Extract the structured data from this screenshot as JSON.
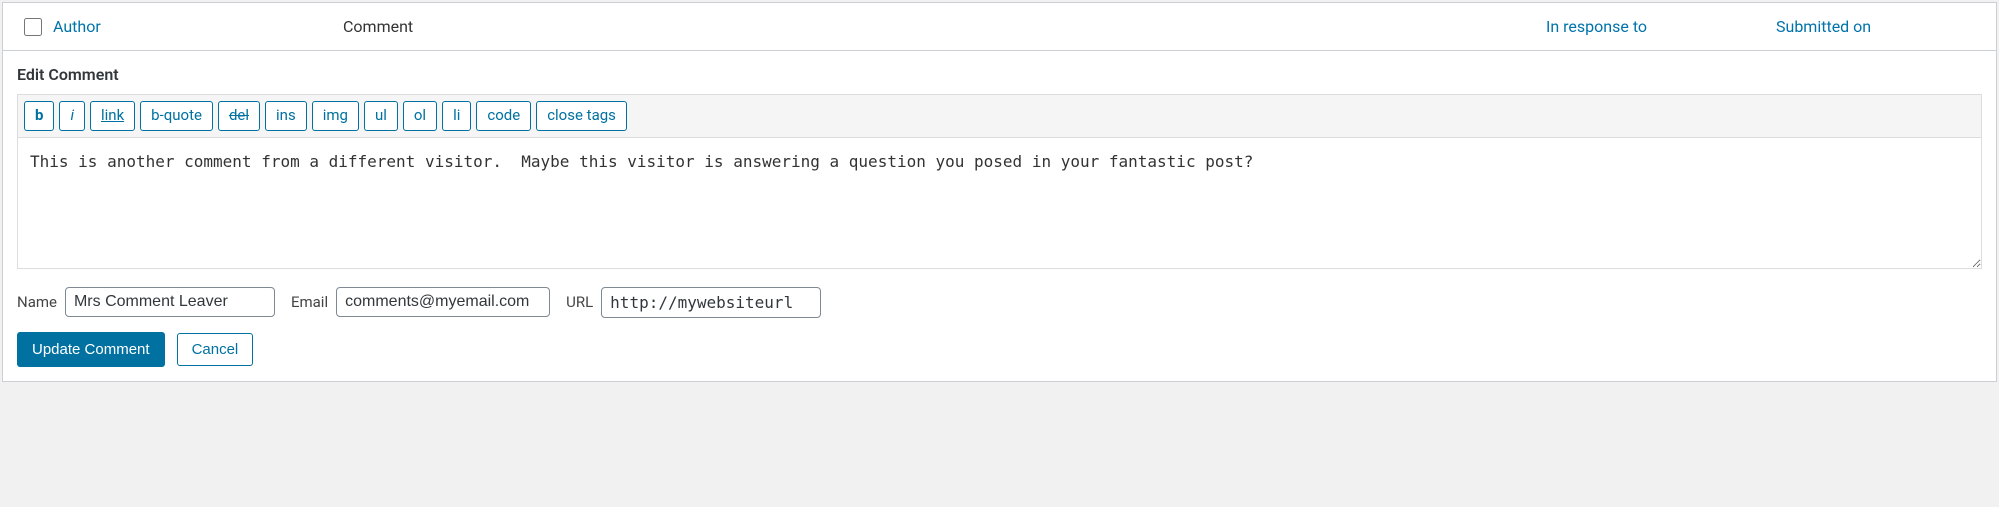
{
  "header": {
    "author": "Author",
    "comment": "Comment",
    "in_response_to": "In response to",
    "submitted_on": "Submitted on"
  },
  "edit": {
    "title": "Edit Comment",
    "toolbar": {
      "b": "b",
      "i": "i",
      "link": "link",
      "bquote": "b-quote",
      "del": "del",
      "ins": "ins",
      "img": "img",
      "ul": "ul",
      "ol": "ol",
      "li": "li",
      "code": "code",
      "close": "close tags"
    },
    "content": "This is another comment from a different visitor.  Maybe this visitor is answering a question you posed in your fantastic post?"
  },
  "fields": {
    "name_label": "Name",
    "name_value": "Mrs Comment Leaver",
    "email_label": "Email",
    "email_value": "comments@myemail.com",
    "url_label": "URL",
    "url_value": "http://mywebsiteurl"
  },
  "actions": {
    "update": "Update Comment",
    "cancel": "Cancel"
  }
}
